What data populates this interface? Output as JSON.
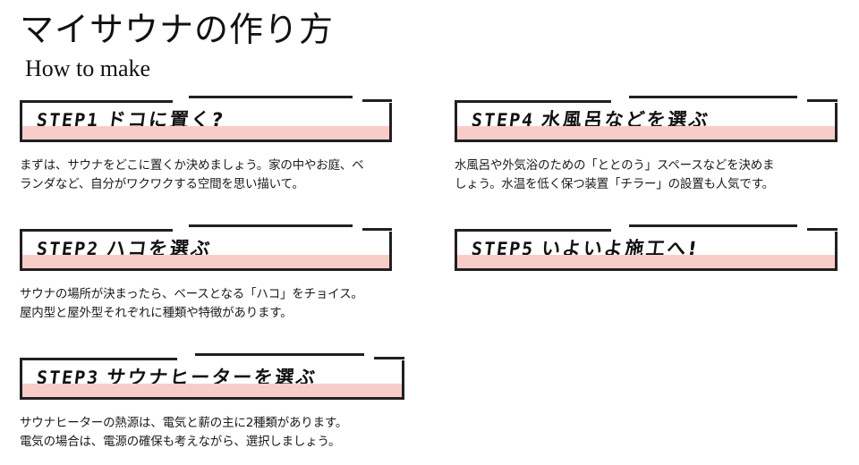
{
  "header": {
    "title": "マイサウナの作り方",
    "subtitle": "How to make"
  },
  "colors": {
    "band": "#f8cdc9",
    "border": "#231f20",
    "text": "#1a1a1a",
    "background": "#ffffff"
  },
  "columns": {
    "left": {
      "steps": [
        {
          "label": "STEP1",
          "heading": "ドコに置く?",
          "body_lines": [
            "まずは、サウナをどこに置くか決めましょう。家の中やお庭、ベ",
            "ランダなど、自分がワクワクする空間を思い描いて。"
          ]
        },
        {
          "label": "STEP2",
          "heading": "ハコを選ぶ",
          "body_lines": [
            "サウナの場所が決まったら、ベースとなる「ハコ」をチョイス。",
            "屋内型と屋外型それぞれに種類や特徴があります。"
          ]
        },
        {
          "label": "STEP3",
          "heading": "サウナヒーターを選ぶ",
          "body_lines": [
            "サウナヒーターの熱源は、電気と薪の主に2種類があります。",
            "電気の場合は、電源の確保も考えながら、選択しましょう。"
          ]
        }
      ]
    },
    "right": {
      "steps": [
        {
          "label": "STEP4",
          "heading": "水風呂などを選ぶ",
          "body_lines": [
            "水風呂や外気浴のための「ととのう」スペースなどを決めま",
            "しょう。水温を低く保つ装置「チラー」の設置も人気です。"
          ]
        },
        {
          "label": "STEP5",
          "heading": "いよいよ施工へ!",
          "body_lines": []
        }
      ]
    }
  }
}
